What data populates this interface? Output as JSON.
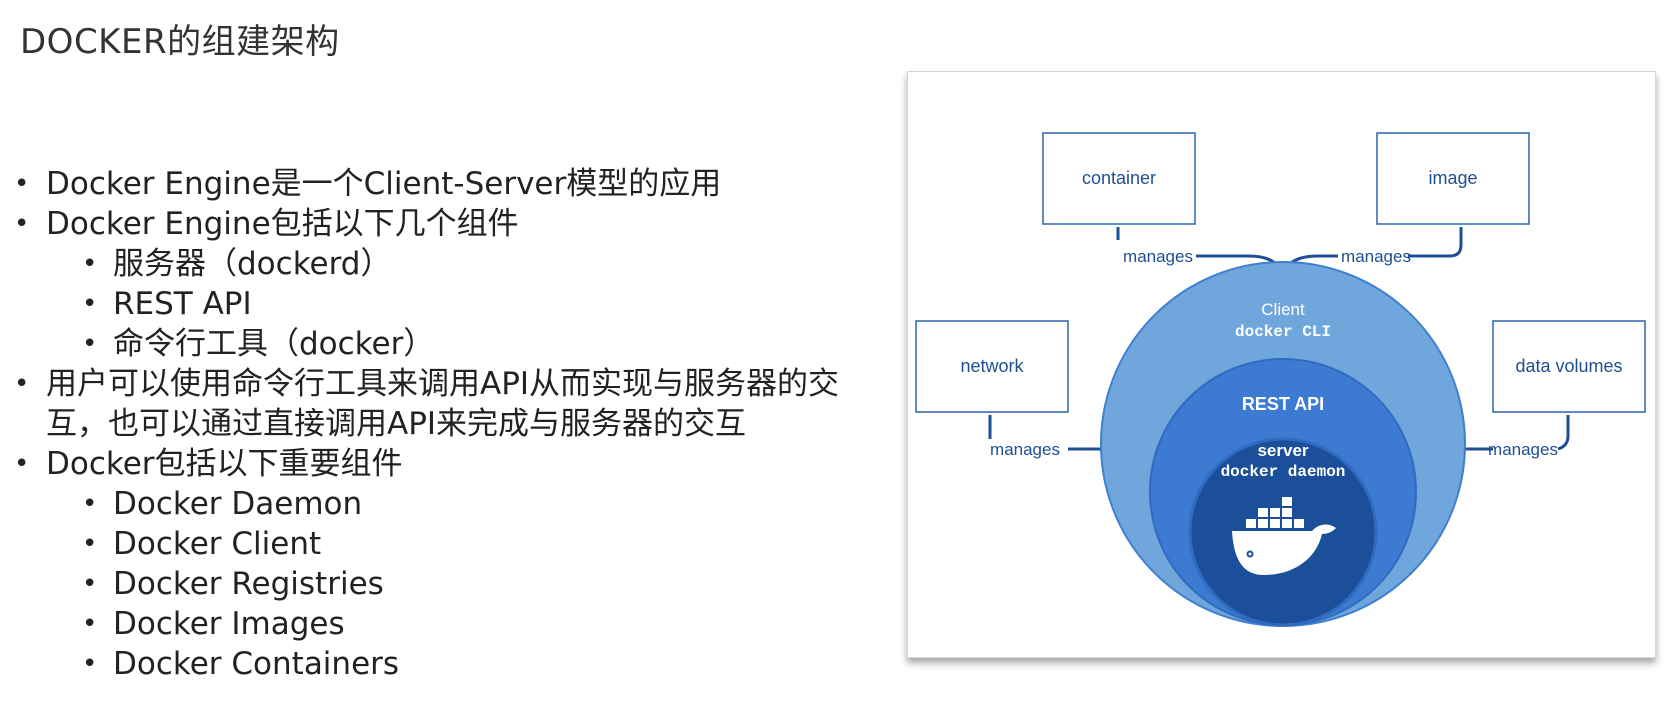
{
  "title": "DOCKER的组建架构",
  "bullets": [
    {
      "level": 1,
      "text": "Docker Engine是一个Client-Server模型的应用"
    },
    {
      "level": 1,
      "text": "Docker Engine包括以下几个组件"
    },
    {
      "level": 2,
      "text": "服务器（dockerd）"
    },
    {
      "level": 2,
      "text": "REST API"
    },
    {
      "level": 2,
      "text": "命令行工具（docker）"
    },
    {
      "level": 1,
      "text": "用户可以使用命令行工具来调用API从而实现与服务器的交互，也可以通过直接调用API来完成与服务器的交互"
    },
    {
      "level": 1,
      "text": "Docker包括以下重要组件"
    },
    {
      "level": 2,
      "text": "Docker Daemon"
    },
    {
      "level": 2,
      "text": "Docker Client"
    },
    {
      "level": 2,
      "text": "Docker Registries"
    },
    {
      "level": 2,
      "text": "Docker Images"
    },
    {
      "level": 2,
      "text": "Docker Containers"
    }
  ],
  "bullet_symbol": "•",
  "diagram": {
    "boxes": {
      "container": "container",
      "image": "image",
      "network": "network",
      "data_volumes": "data volumes"
    },
    "edge_label": "manages",
    "client": {
      "title": "Client",
      "subtitle": "docker CLI"
    },
    "rest_api": "REST API",
    "server": {
      "title": "server",
      "subtitle": "docker daemon"
    },
    "colors": {
      "outer_circle": "#6fa6dc",
      "middle_circle": "#3d7ad1",
      "inner_circle": "#1b4f9a",
      "line": "#1f4f92",
      "box_border": "#2b63ad",
      "box_text": "#1f4f92"
    },
    "icons": [
      "docker-whale-logo-icon"
    ]
  }
}
